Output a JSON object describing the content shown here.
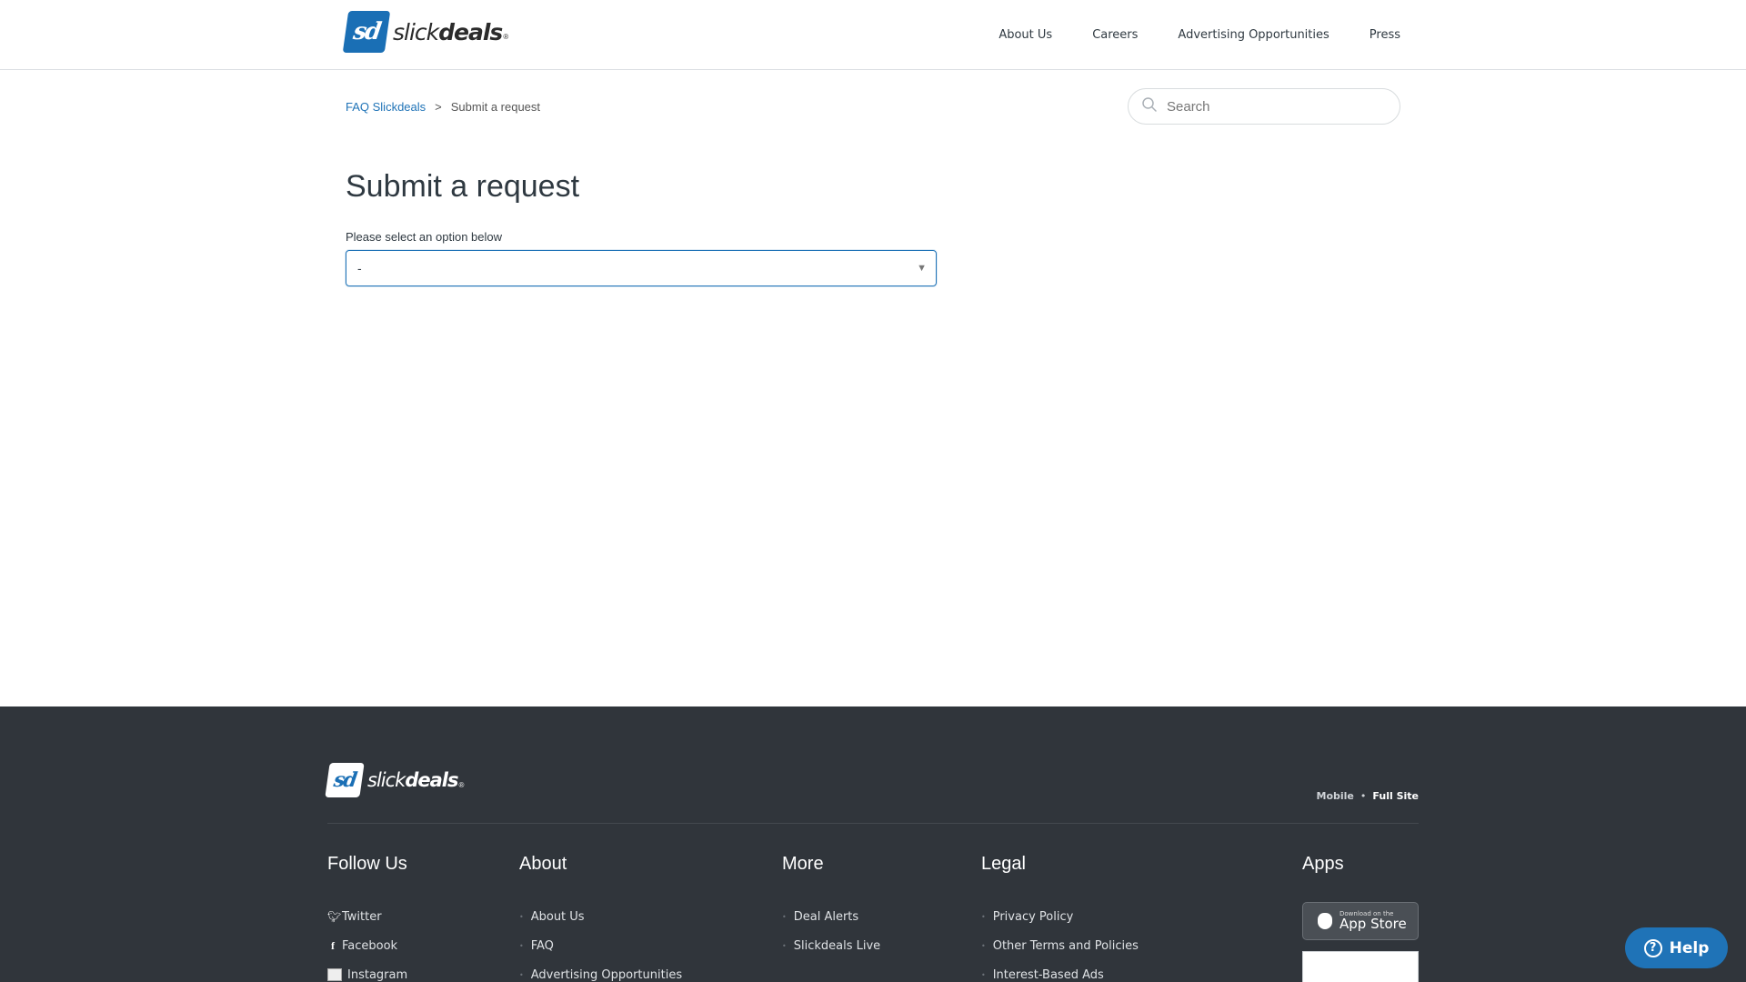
{
  "header": {
    "logo_mark": "sd",
    "logo_text_light": "slick",
    "logo_text_bold": "deals",
    "logo_reg": "®",
    "nav": [
      {
        "label": "About Us"
      },
      {
        "label": "Careers"
      },
      {
        "label": "Advertising Opportunities"
      },
      {
        "label": "Press"
      }
    ]
  },
  "breadcrumbs": {
    "home": "FAQ Slickdeals",
    "separator": ">",
    "current": "Submit a request"
  },
  "search": {
    "placeholder": "Search",
    "icon": "search-icon"
  },
  "main": {
    "title": "Submit a request",
    "field_label": "Please select an option below",
    "select_value": "-",
    "select_arrow": "▼"
  },
  "footer": {
    "background": "#30353b",
    "logo_mark": "sd",
    "logo_text_light": "slick",
    "logo_text_bold": "deals",
    "logo_reg": "®",
    "switch": {
      "mobile": "Mobile",
      "separator": "•",
      "full": "Full Site"
    },
    "columns": {
      "follow": {
        "title": "Follow Us",
        "items": [
          {
            "label": "Twitter",
            "icon": "twitter-icon"
          },
          {
            "label": "Facebook",
            "icon": "facebook-icon"
          },
          {
            "label": "Instagram",
            "icon": "instagram-icon"
          }
        ]
      },
      "about": {
        "title": "About",
        "items": [
          {
            "label": "About Us"
          },
          {
            "label": "FAQ"
          },
          {
            "label": "Advertising Opportunities"
          }
        ]
      },
      "more": {
        "title": "More",
        "items": [
          {
            "label": "Deal Alerts"
          },
          {
            "label": "Slickdeals Live"
          }
        ]
      },
      "legal": {
        "title": "Legal",
        "items": [
          {
            "label": "Privacy Policy"
          },
          {
            "label": "Other Terms and Policies"
          },
          {
            "label": "Interest-Based Ads"
          }
        ]
      },
      "apps": {
        "title": "Apps",
        "appstore_small": "Download on the",
        "appstore_big": "App Store"
      }
    }
  },
  "help_button": {
    "label": "Help",
    "color": "#1f73b7"
  },
  "colors": {
    "accent": "#1f73b7",
    "brand": "#1a6fb5"
  }
}
